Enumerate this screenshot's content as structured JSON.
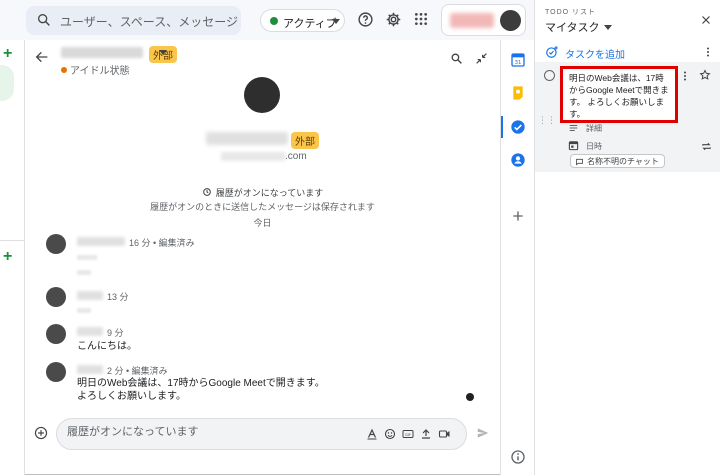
{
  "topbar": {
    "search_placeholder": "ユーザー、スペース、メッセージを検索",
    "status_label": "アクティブ",
    "status_color": "#1e8e3e",
    "icons": [
      "search-icon",
      "help-icon",
      "gear-icon",
      "apps-grid-icon"
    ]
  },
  "chat": {
    "header": {
      "badge": "外部",
      "status": "アイドル状態"
    },
    "profile": {
      "badge": "外部",
      "email_domain": ".com"
    },
    "history_on": "履歴がオンになっています",
    "history_sub": "履歴がオンのときに送信したメッセージは保存されます",
    "date_divider": "今日",
    "messages": [
      {
        "meta": "16 分 • 編集済み",
        "text": ""
      },
      {
        "meta": "13 分",
        "text": ""
      },
      {
        "meta": "9 分",
        "text": "こんにちは。"
      },
      {
        "meta": "2 分 • 編集済み",
        "line1": "明日のWeb会議は、17時からGoogle Meetで開きます。",
        "line2": "よろしくお願いします。"
      }
    ],
    "compose_placeholder": "履歴がオンになっています"
  },
  "tasks": {
    "header_small": "TODO リスト",
    "header": "マイタスク",
    "add_label": "タスクを追加",
    "task_text": "明日のWeb会議は、17時からGoogle Meetで開きます。 よろしくお願いします。",
    "detail_label": "詳細",
    "date_label": "日時",
    "chip_label": "名称不明のチャット",
    "highlight_color": "#e00000"
  }
}
